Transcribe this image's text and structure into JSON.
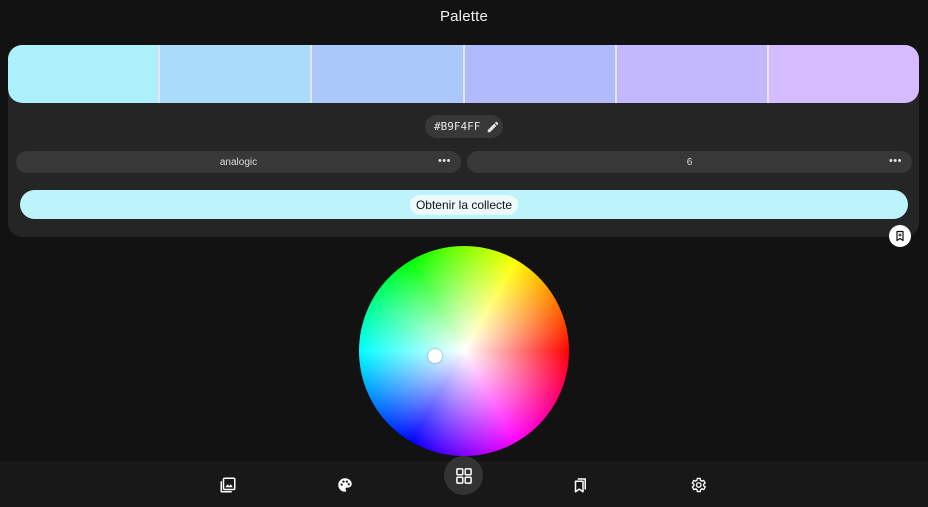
{
  "header": {
    "title": "Palette"
  },
  "palette": {
    "swatches": [
      "#abf0fa",
      "#abdbfa",
      "#abc8fa",
      "#b0bbfd",
      "#c3b7fd",
      "#d5bbff"
    ],
    "hex_value": "#B9F4FF"
  },
  "controls": {
    "scheme_value": "analogic",
    "count_value": "6",
    "more_glyph": "•••",
    "collect_label": "Obtenir la collecte"
  },
  "colors": {
    "accent": "#bdf3fb",
    "background": "#121212",
    "card": "#252525",
    "chip": "#383838"
  },
  "icons": {
    "edit": "pencil-icon",
    "bookmark": "bookmark-icon",
    "nav": [
      "gallery-icon",
      "palette-icon",
      "grid-icon",
      "bookmarks-icon",
      "gear-icon"
    ]
  }
}
